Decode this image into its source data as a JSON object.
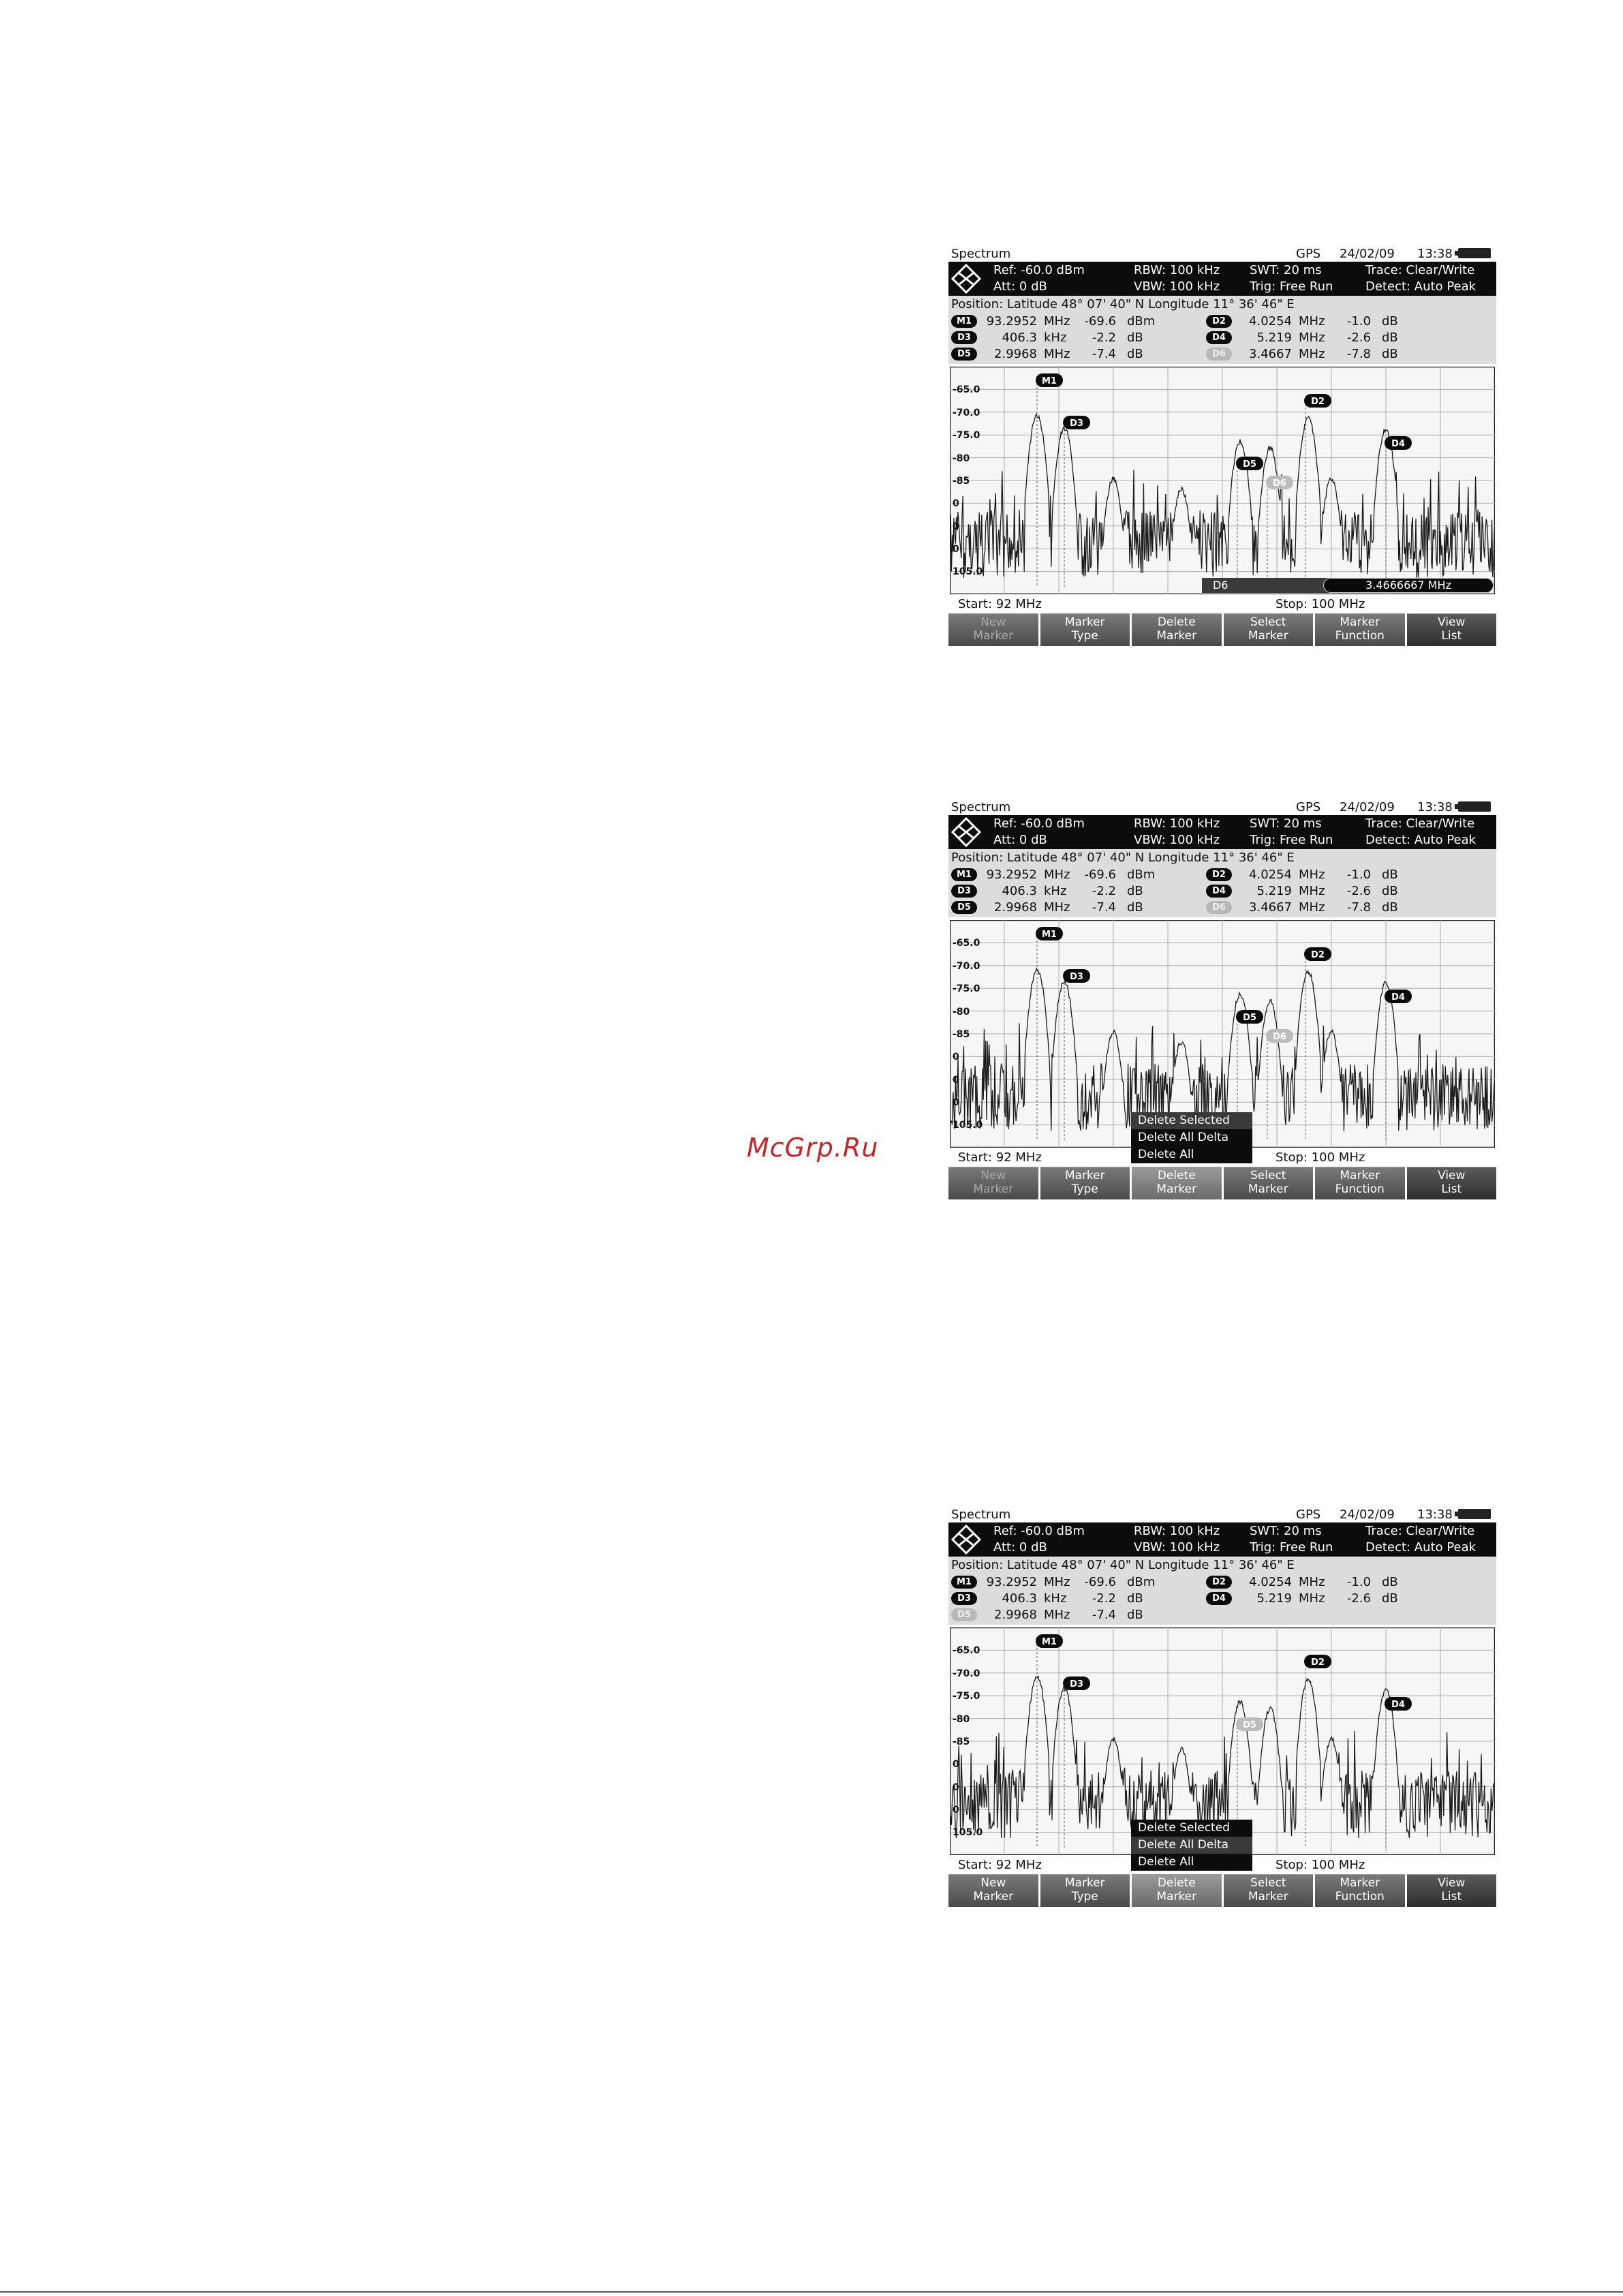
{
  "watermark": "McGrp.Ru",
  "screens": [
    {
      "title": "Spectrum",
      "gps": "GPS",
      "date": "24/02/09",
      "time": "13:38",
      "params": {
        "ref": "Ref:  -60.0 dBm",
        "att": "Att:  0 dB",
        "rbw": "RBW:  100 kHz",
        "vbw": "VBW:  100 kHz",
        "swt": "SWT:  20 ms",
        "trig": "Trig:  Free Run",
        "trace": "Trace:  Clear/Write",
        "detect": "Detect:  Auto Peak"
      },
      "position": "Position:  Latitude 48° 07' 40\" N   Longitude 11° 36' 46\" E",
      "marker_rows": [
        {
          "left": {
            "id": "M1",
            "freq": "93.2952",
            "funit": "MHz",
            "level": "-69.6",
            "lunit": "dBm",
            "dim": false
          },
          "right": {
            "id": "D2",
            "freq": "4.0254",
            "funit": "MHz",
            "level": "-1.0",
            "lunit": "dB",
            "dim": false
          }
        },
        {
          "left": {
            "id": "D3",
            "freq": "406.3",
            "funit": "kHz",
            "level": "-2.2",
            "lunit": "dB",
            "dim": false
          },
          "right": {
            "id": "D4",
            "freq": "5.219",
            "funit": "MHz",
            "level": "-2.6",
            "lunit": "dB",
            "dim": false
          }
        },
        {
          "left": {
            "id": "D5",
            "freq": "2.9968",
            "funit": "MHz",
            "level": "-7.4",
            "lunit": "dB",
            "dim": false
          },
          "right": {
            "id": "D6",
            "freq": "3.4667",
            "funit": "MHz",
            "level": "-7.8",
            "lunit": "dB",
            "dim": true
          }
        }
      ],
      "y_ticks": [
        "-65.0",
        "-70.0",
        "-75.0",
        "-80",
        "-85",
        "0",
        "0",
        "0",
        "105.0"
      ],
      "status": {
        "label": "D6",
        "value": "3.4666667 MHz"
      },
      "start": "Start:    92 MHz",
      "stop": "Stop:    100 MHz",
      "softkeys": [
        {
          "l1": "New",
          "l2": "Marker",
          "state": "dim"
        },
        {
          "l1": "Marker",
          "l2": "Type",
          "state": ""
        },
        {
          "l1": "Delete",
          "l2": "Marker",
          "state": ""
        },
        {
          "l1": "Select",
          "l2": "Marker",
          "state": ""
        },
        {
          "l1": "Marker",
          "l2": "Function",
          "state": ""
        },
        {
          "l1": "View",
          "l2": "List",
          "state": "view"
        }
      ],
      "popup": []
    },
    {
      "title": "Spectrum",
      "gps": "GPS",
      "date": "24/02/09",
      "time": "13:38",
      "params": {
        "ref": "Ref:  -60.0 dBm",
        "att": "Att:  0 dB",
        "rbw": "RBW:  100 kHz",
        "vbw": "VBW:  100 kHz",
        "swt": "SWT:  20 ms",
        "trig": "Trig:  Free Run",
        "trace": "Trace:  Clear/Write",
        "detect": "Detect:  Auto Peak"
      },
      "position": "Position:  Latitude 48° 07' 40\" N   Longitude 11° 36' 46\" E",
      "marker_rows": [
        {
          "left": {
            "id": "M1",
            "freq": "93.2952",
            "funit": "MHz",
            "level": "-69.6",
            "lunit": "dBm",
            "dim": false
          },
          "right": {
            "id": "D2",
            "freq": "4.0254",
            "funit": "MHz",
            "level": "-1.0",
            "lunit": "dB",
            "dim": false
          }
        },
        {
          "left": {
            "id": "D3",
            "freq": "406.3",
            "funit": "kHz",
            "level": "-2.2",
            "lunit": "dB",
            "dim": false
          },
          "right": {
            "id": "D4",
            "freq": "5.219",
            "funit": "MHz",
            "level": "-2.6",
            "lunit": "dB",
            "dim": false
          }
        },
        {
          "left": {
            "id": "D5",
            "freq": "2.9968",
            "funit": "MHz",
            "level": "-7.4",
            "lunit": "dB",
            "dim": false
          },
          "right": {
            "id": "D6",
            "freq": "3.4667",
            "funit": "MHz",
            "level": "-7.8",
            "lunit": "dB",
            "dim": true
          }
        }
      ],
      "y_ticks": [
        "-65.0",
        "-70.0",
        "-75.0",
        "-80",
        "-85",
        "0",
        "0",
        "0",
        "105.0"
      ],
      "status": null,
      "start": "Start:    92 MHz",
      "stop": "Stop:    100 MHz",
      "softkeys": [
        {
          "l1": "New",
          "l2": "Marker",
          "state": "dim"
        },
        {
          "l1": "Marker",
          "l2": "Type",
          "state": ""
        },
        {
          "l1": "Delete",
          "l2": "Marker",
          "state": "active"
        },
        {
          "l1": "Select",
          "l2": "Marker",
          "state": ""
        },
        {
          "l1": "Marker",
          "l2": "Function",
          "state": ""
        },
        {
          "l1": "View",
          "l2": "List",
          "state": "view"
        }
      ],
      "popup": [
        {
          "label": "Delete Selected",
          "hl": true
        },
        {
          "label": "Delete All Delta",
          "hl": false
        },
        {
          "label": "Delete All",
          "hl": false
        }
      ]
    },
    {
      "title": "Spectrum",
      "gps": "GPS",
      "date": "24/02/09",
      "time": "13:38",
      "params": {
        "ref": "Ref:  -60.0 dBm",
        "att": "Att:  0 dB",
        "rbw": "RBW:  100 kHz",
        "vbw": "VBW:  100 kHz",
        "swt": "SWT:  20 ms",
        "trig": "Trig:  Free Run",
        "trace": "Trace:  Clear/Write",
        "detect": "Detect:  Auto Peak"
      },
      "position": "Position:  Latitude 48° 07' 40\" N   Longitude 11° 36' 46\" E",
      "marker_rows": [
        {
          "left": {
            "id": "M1",
            "freq": "93.2952",
            "funit": "MHz",
            "level": "-69.6",
            "lunit": "dBm",
            "dim": false
          },
          "right": {
            "id": "D2",
            "freq": "4.0254",
            "funit": "MHz",
            "level": "-1.0",
            "lunit": "dB",
            "dim": false
          }
        },
        {
          "left": {
            "id": "D3",
            "freq": "406.3",
            "funit": "kHz",
            "level": "-2.2",
            "lunit": "dB",
            "dim": false
          },
          "right": {
            "id": "D4",
            "freq": "5.219",
            "funit": "MHz",
            "level": "-2.6",
            "lunit": "dB",
            "dim": false
          }
        },
        {
          "left": {
            "id": "D5",
            "freq": "2.9968",
            "funit": "MHz",
            "level": "-7.4",
            "lunit": "dB",
            "dim": true
          },
          "right": null
        }
      ],
      "y_ticks": [
        "-65.0",
        "-70.0",
        "-75.0",
        "-80",
        "-85",
        "0",
        "0",
        "0",
        "105.0"
      ],
      "status": null,
      "start": "Start:    92 MHz",
      "stop": "Stop:    100 MHz",
      "softkeys": [
        {
          "l1": "New",
          "l2": "Marker",
          "state": ""
        },
        {
          "l1": "Marker",
          "l2": "Type",
          "state": ""
        },
        {
          "l1": "Delete",
          "l2": "Marker",
          "state": "active"
        },
        {
          "l1": "Select",
          "l2": "Marker",
          "state": ""
        },
        {
          "l1": "Marker",
          "l2": "Function",
          "state": ""
        },
        {
          "l1": "View",
          "l2": "List",
          "state": "view"
        }
      ],
      "popup": [
        {
          "label": "Delete Selected",
          "hl": false
        },
        {
          "label": "Delete All Delta",
          "hl": true
        },
        {
          "label": "Delete All",
          "hl": false
        }
      ]
    }
  ]
}
